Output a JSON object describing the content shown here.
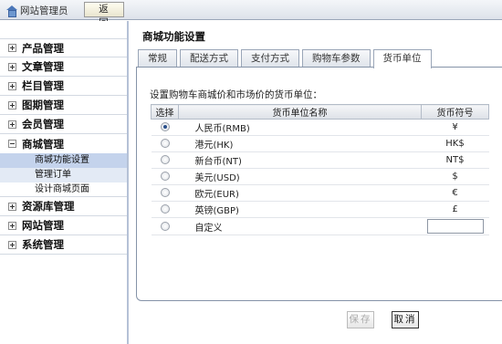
{
  "topbar": {
    "site_label": "网站管理员",
    "back_label": "返 回"
  },
  "sidebar": {
    "items": [
      {
        "label": "产品管理",
        "expanded": false
      },
      {
        "label": "文章管理",
        "expanded": false
      },
      {
        "label": "栏目管理",
        "expanded": false
      },
      {
        "label": "图期管理",
        "expanded": false
      },
      {
        "label": "会员管理",
        "expanded": false
      },
      {
        "label": "商城管理",
        "expanded": true
      },
      {
        "label": "资源库管理",
        "expanded": false
      },
      {
        "label": "网站管理",
        "expanded": false
      },
      {
        "label": "系统管理",
        "expanded": false
      }
    ],
    "subitems": [
      {
        "label": "商城功能设置",
        "active": true
      },
      {
        "label": "管理订单",
        "active": false
      },
      {
        "label": "设计商城页面",
        "active": false
      }
    ]
  },
  "main": {
    "title": "商城功能设置",
    "tabs": [
      "常规",
      "配送方式",
      "支付方式",
      "购物车参数",
      "货币单位"
    ],
    "active_tab": "货币单位",
    "description": "设置购物车商城价和市场价的货币单位：",
    "table": {
      "headers": [
        "选择",
        "货币单位名称",
        "货币符号"
      ],
      "rows": [
        {
          "name": "人民币(RMB)",
          "symbol": "¥",
          "selected": true
        },
        {
          "name": "港元(HK)",
          "symbol": "HK$",
          "selected": false
        },
        {
          "name": "新台币(NT)",
          "symbol": "NT$",
          "selected": false
        },
        {
          "name": "美元(USD)",
          "symbol": "$",
          "selected": false
        },
        {
          "name": "欧元(EUR)",
          "symbol": "€",
          "selected": false
        },
        {
          "name": "英镑(GBP)",
          "symbol": "£",
          "selected": false
        },
        {
          "name": "自定义",
          "symbol": "",
          "selected": false
        }
      ]
    },
    "save_label": "保存",
    "cancel_label": "取消"
  }
}
